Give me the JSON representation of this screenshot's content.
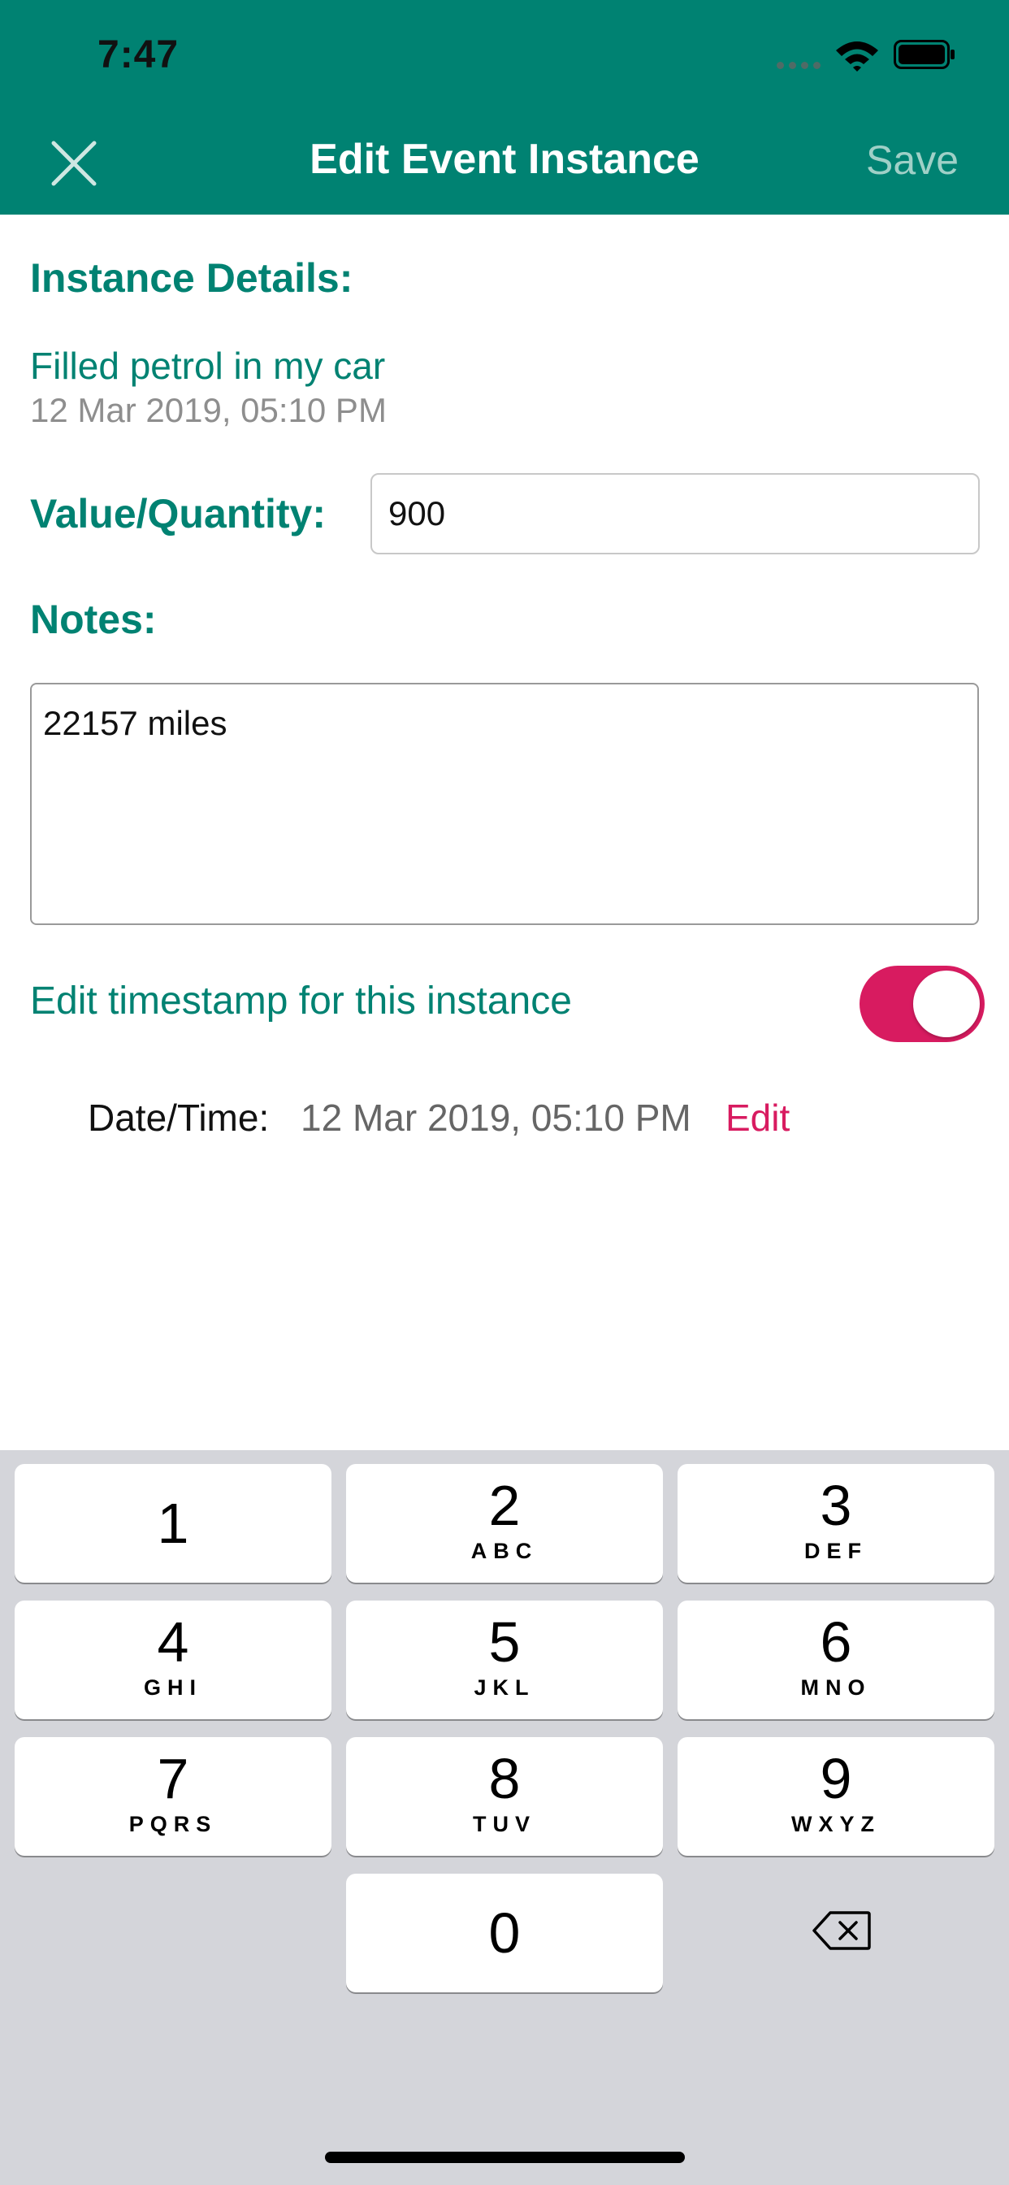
{
  "status_bar": {
    "time": "7:47"
  },
  "nav": {
    "title": "Edit Event Instance",
    "save_label": "Save"
  },
  "instance": {
    "section_title": "Instance Details:",
    "event_name": "Filled petrol in my car",
    "event_timestamp": "12 Mar 2019, 05:10 PM"
  },
  "quantity": {
    "label": "Value/Quantity:",
    "value": "900"
  },
  "notes": {
    "label": "Notes:",
    "value": "22157 miles"
  },
  "timestamp_toggle": {
    "label": "Edit timestamp for this instance",
    "on": true
  },
  "datetime": {
    "label": "Date/Time:",
    "value": "12 Mar 2019, 05:10 PM",
    "edit_label": "Edit"
  },
  "keypad": {
    "keys": [
      {
        "digit": "1",
        "letters": ""
      },
      {
        "digit": "2",
        "letters": "ABC"
      },
      {
        "digit": "3",
        "letters": "DEF"
      },
      {
        "digit": "4",
        "letters": "GHI"
      },
      {
        "digit": "5",
        "letters": "JKL"
      },
      {
        "digit": "6",
        "letters": "MNO"
      },
      {
        "digit": "7",
        "letters": "PQRS"
      },
      {
        "digit": "8",
        "letters": "TUV"
      },
      {
        "digit": "9",
        "letters": "WXYZ"
      },
      {
        "digit": "0",
        "letters": ""
      }
    ]
  },
  "colors": {
    "header": "#008272",
    "accent": "#d81b60",
    "keyboard_bg": "#d4d5da"
  },
  "icons": [
    "close-icon",
    "wifi-icon",
    "battery-icon",
    "backspace-icon"
  ]
}
